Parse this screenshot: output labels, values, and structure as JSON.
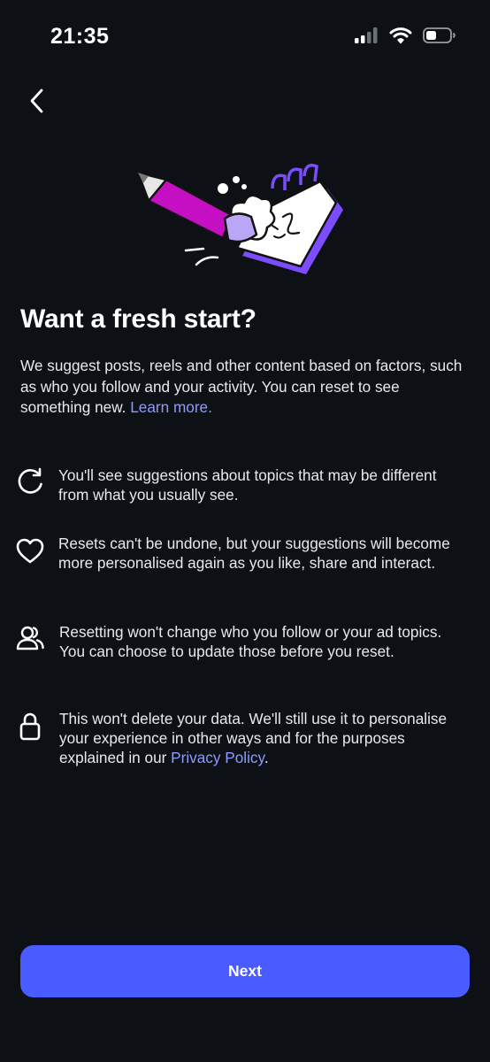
{
  "status_bar": {
    "time": "21:35",
    "icons": [
      "cellular-signal-icon",
      "wifi-icon",
      "battery-icon"
    ]
  },
  "nav": {
    "back_icon": "chevron-left-icon"
  },
  "illustration": {
    "name": "pencil-notebook-illustration"
  },
  "title": "Want a fresh start?",
  "intro": {
    "text": "We suggest posts, reels and other content based on factors, such as who you follow and your activity. You can reset to see something new.",
    "link": "Learn more."
  },
  "items": [
    {
      "icon": "refresh-icon",
      "text": "You'll see suggestions about topics that may be different from what you usually see."
    },
    {
      "icon": "heart-icon",
      "text": "Resets can't be undone, but your suggestions will become more personalised again as you like, share and interact."
    },
    {
      "icon": "people-icon",
      "text": "Resetting won't change who you follow or your ad topics. You can choose to update those before you reset."
    },
    {
      "icon": "lock-icon",
      "text": "This won't delete your data. We'll still use it to personalise your experience in other ways and for the purposes explained in our",
      "link": "Privacy Policy",
      "suffix": "."
    }
  ],
  "next_button": {
    "label": "Next"
  },
  "colors": {
    "background": "#0d1116",
    "accent": "#4a5cff",
    "link": "#8c9bff",
    "illustration_magenta": "#c40fc2",
    "illustration_purple": "#7b4dff"
  }
}
